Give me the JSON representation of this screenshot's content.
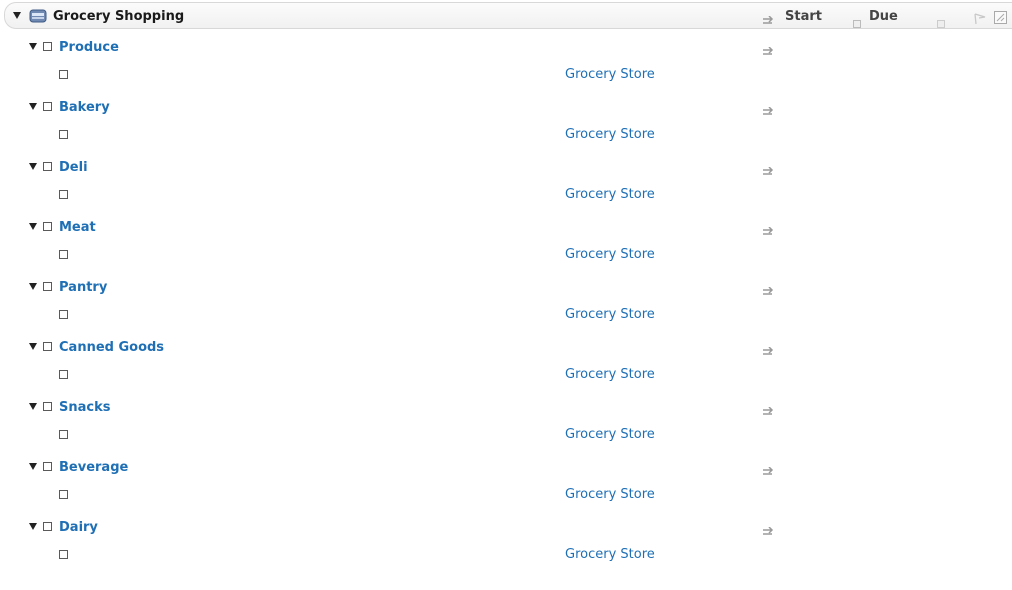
{
  "project": {
    "title": "Grocery Shopping",
    "icon": "basket-icon"
  },
  "columns": {
    "start": "Start",
    "due": "Due"
  },
  "groups": [
    {
      "title": "Produce",
      "tasks": [
        {
          "context": "Grocery Store"
        }
      ]
    },
    {
      "title": "Bakery",
      "tasks": [
        {
          "context": "Grocery Store"
        }
      ]
    },
    {
      "title": "Deli",
      "tasks": [
        {
          "context": "Grocery Store"
        }
      ]
    },
    {
      "title": "Meat",
      "tasks": [
        {
          "context": "Grocery Store"
        }
      ]
    },
    {
      "title": "Pantry",
      "tasks": [
        {
          "context": "Grocery Store"
        }
      ]
    },
    {
      "title": "Canned Goods",
      "tasks": [
        {
          "context": "Grocery Store"
        }
      ]
    },
    {
      "title": "Snacks",
      "tasks": [
        {
          "context": "Grocery Store"
        }
      ]
    },
    {
      "title": "Beverage",
      "tasks": [
        {
          "context": "Grocery Store"
        }
      ]
    },
    {
      "title": "Dairy",
      "tasks": [
        {
          "context": "Grocery Store"
        }
      ]
    }
  ],
  "colors": {
    "link": "#1f6fb5",
    "icon_gray": "#9a9a9a"
  }
}
